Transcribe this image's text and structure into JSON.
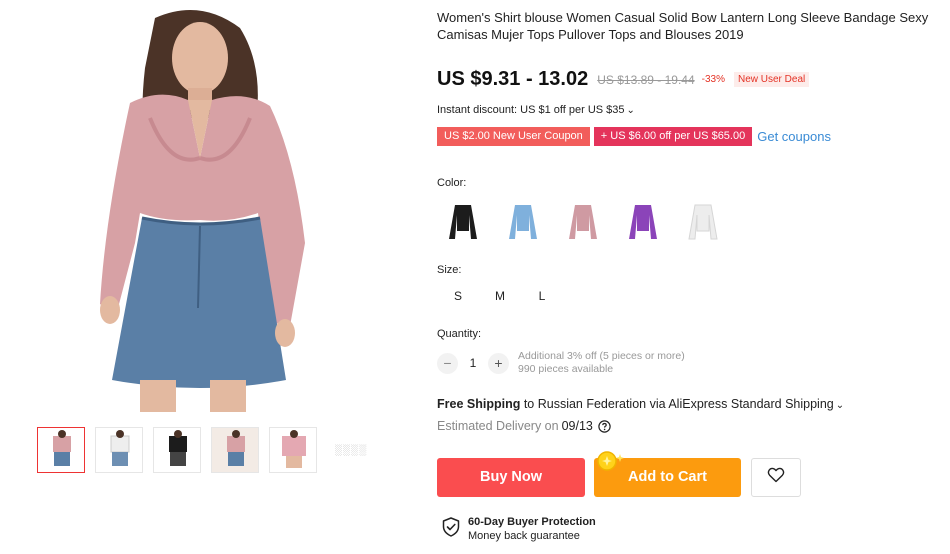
{
  "product": {
    "title": "Women's Shirt blouse Women Casual Solid Bow Lantern Long Sleeve Bandage Sexy Camisas Mujer Tops Pullover Tops and Blouses 2019",
    "price": "US $9.31 - 13.02",
    "original_price": "US $13.89 - 19.44",
    "discount": "-33%",
    "deal_badge": "New User Deal"
  },
  "promo": {
    "instant_discount": "Instant discount: US $1 off per US $35",
    "coupon_1": "US $2.00 New User Coupon",
    "coupon_2": "+ US $6.00 off per US $65.00",
    "get_coupons": "Get coupons"
  },
  "options": {
    "color_label": "Color:",
    "colors": [
      {
        "name": "black",
        "hex": "#1c1c1c"
      },
      {
        "name": "blue",
        "hex": "#7fb0dc"
      },
      {
        "name": "pink",
        "hex": "#cf9aa2"
      },
      {
        "name": "purple",
        "hex": "#8b44b9"
      },
      {
        "name": "white",
        "hex": "#ededed"
      }
    ],
    "size_label": "Size:",
    "sizes": [
      "S",
      "M",
      "L"
    ],
    "quantity_label": "Quantity:",
    "quantity": "1",
    "qty_minus": "−",
    "qty_plus": "+",
    "qty_note": "Additional 3% off (5 pieces or more)",
    "stock": "990 pieces available"
  },
  "shipping": {
    "free": "Free Shipping",
    "to_text": " to Russian Federation via AliExpress Standard Shipping",
    "estimated_label": "Estimated Delivery on",
    "estimated_date": "09/13"
  },
  "actions": {
    "buy_now": "Buy Now",
    "add_to_cart": "Add to Cart"
  },
  "protection": {
    "title": "60-Day Buyer Protection",
    "subtitle": "Money back guarantee"
  },
  "gallery": {
    "more": "░░░░"
  },
  "colors": {
    "price_red": "#e43225",
    "buy_now": "#fa4d4f",
    "add_to_cart": "#fc9b0e",
    "link_blue": "#3a8bd5"
  }
}
